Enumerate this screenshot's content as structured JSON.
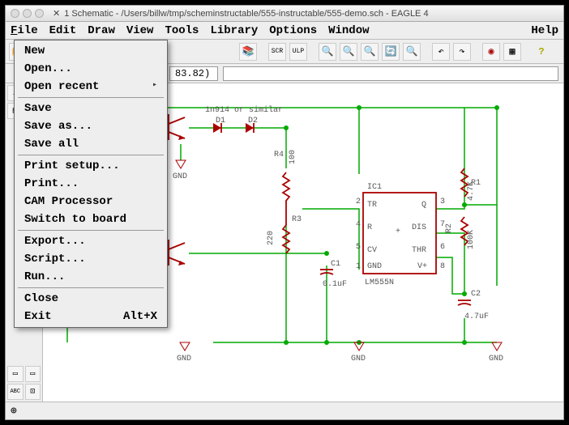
{
  "window": {
    "title": "1 Schematic - /Users/billw/tmp/scheminstructable/555-instructable/555-demo.sch - EAGLE 4"
  },
  "menubar": {
    "file": "File",
    "edit": "Edit",
    "draw": "Draw",
    "view": "View",
    "tools": "Tools",
    "library": "Library",
    "options": "Options",
    "window": "Window",
    "help": "Help"
  },
  "file_menu": {
    "new": "New",
    "open": "Open...",
    "open_recent": "Open recent",
    "save": "Save",
    "save_as": "Save as...",
    "save_all": "Save all",
    "print_setup": "Print setup...",
    "print": "Print...",
    "cam": "CAM Processor",
    "switch": "Switch to board",
    "export": "Export...",
    "script": "Script...",
    "run": "Run...",
    "close": "Close",
    "exit": "Exit",
    "exit_accel": "Alt+X"
  },
  "coords": {
    "value": "83.82)"
  },
  "schematic": {
    "d_label": "1n914 or similar",
    "d1": "D1",
    "d2": "D2",
    "r4": "R4",
    "r4v": "100",
    "r3": "R3",
    "r3v": "220",
    "r1": "R1",
    "r1v": "4.7K",
    "r2": "R2",
    "r2v": "100K",
    "c1": "C1",
    "c1v": "0.1uF",
    "c2": "C2",
    "c2v": "4.7uF",
    "ic1": "IC1",
    "ic_name": "LM555N",
    "tr": "TR",
    "q": "Q",
    "r": "R",
    "dis": "DIS",
    "cv": "CV",
    "thr": "THR",
    "gnd_pin": "GND",
    "vpin": "V+",
    "gnd": "GND",
    "pin2": "2",
    "pin4": "4",
    "pin5": "5",
    "pin1": "1",
    "pin3": "3",
    "pin7": "7",
    "pin6": "6",
    "pin8": "8"
  },
  "status": {
    "zoom_icon": "⊕"
  }
}
